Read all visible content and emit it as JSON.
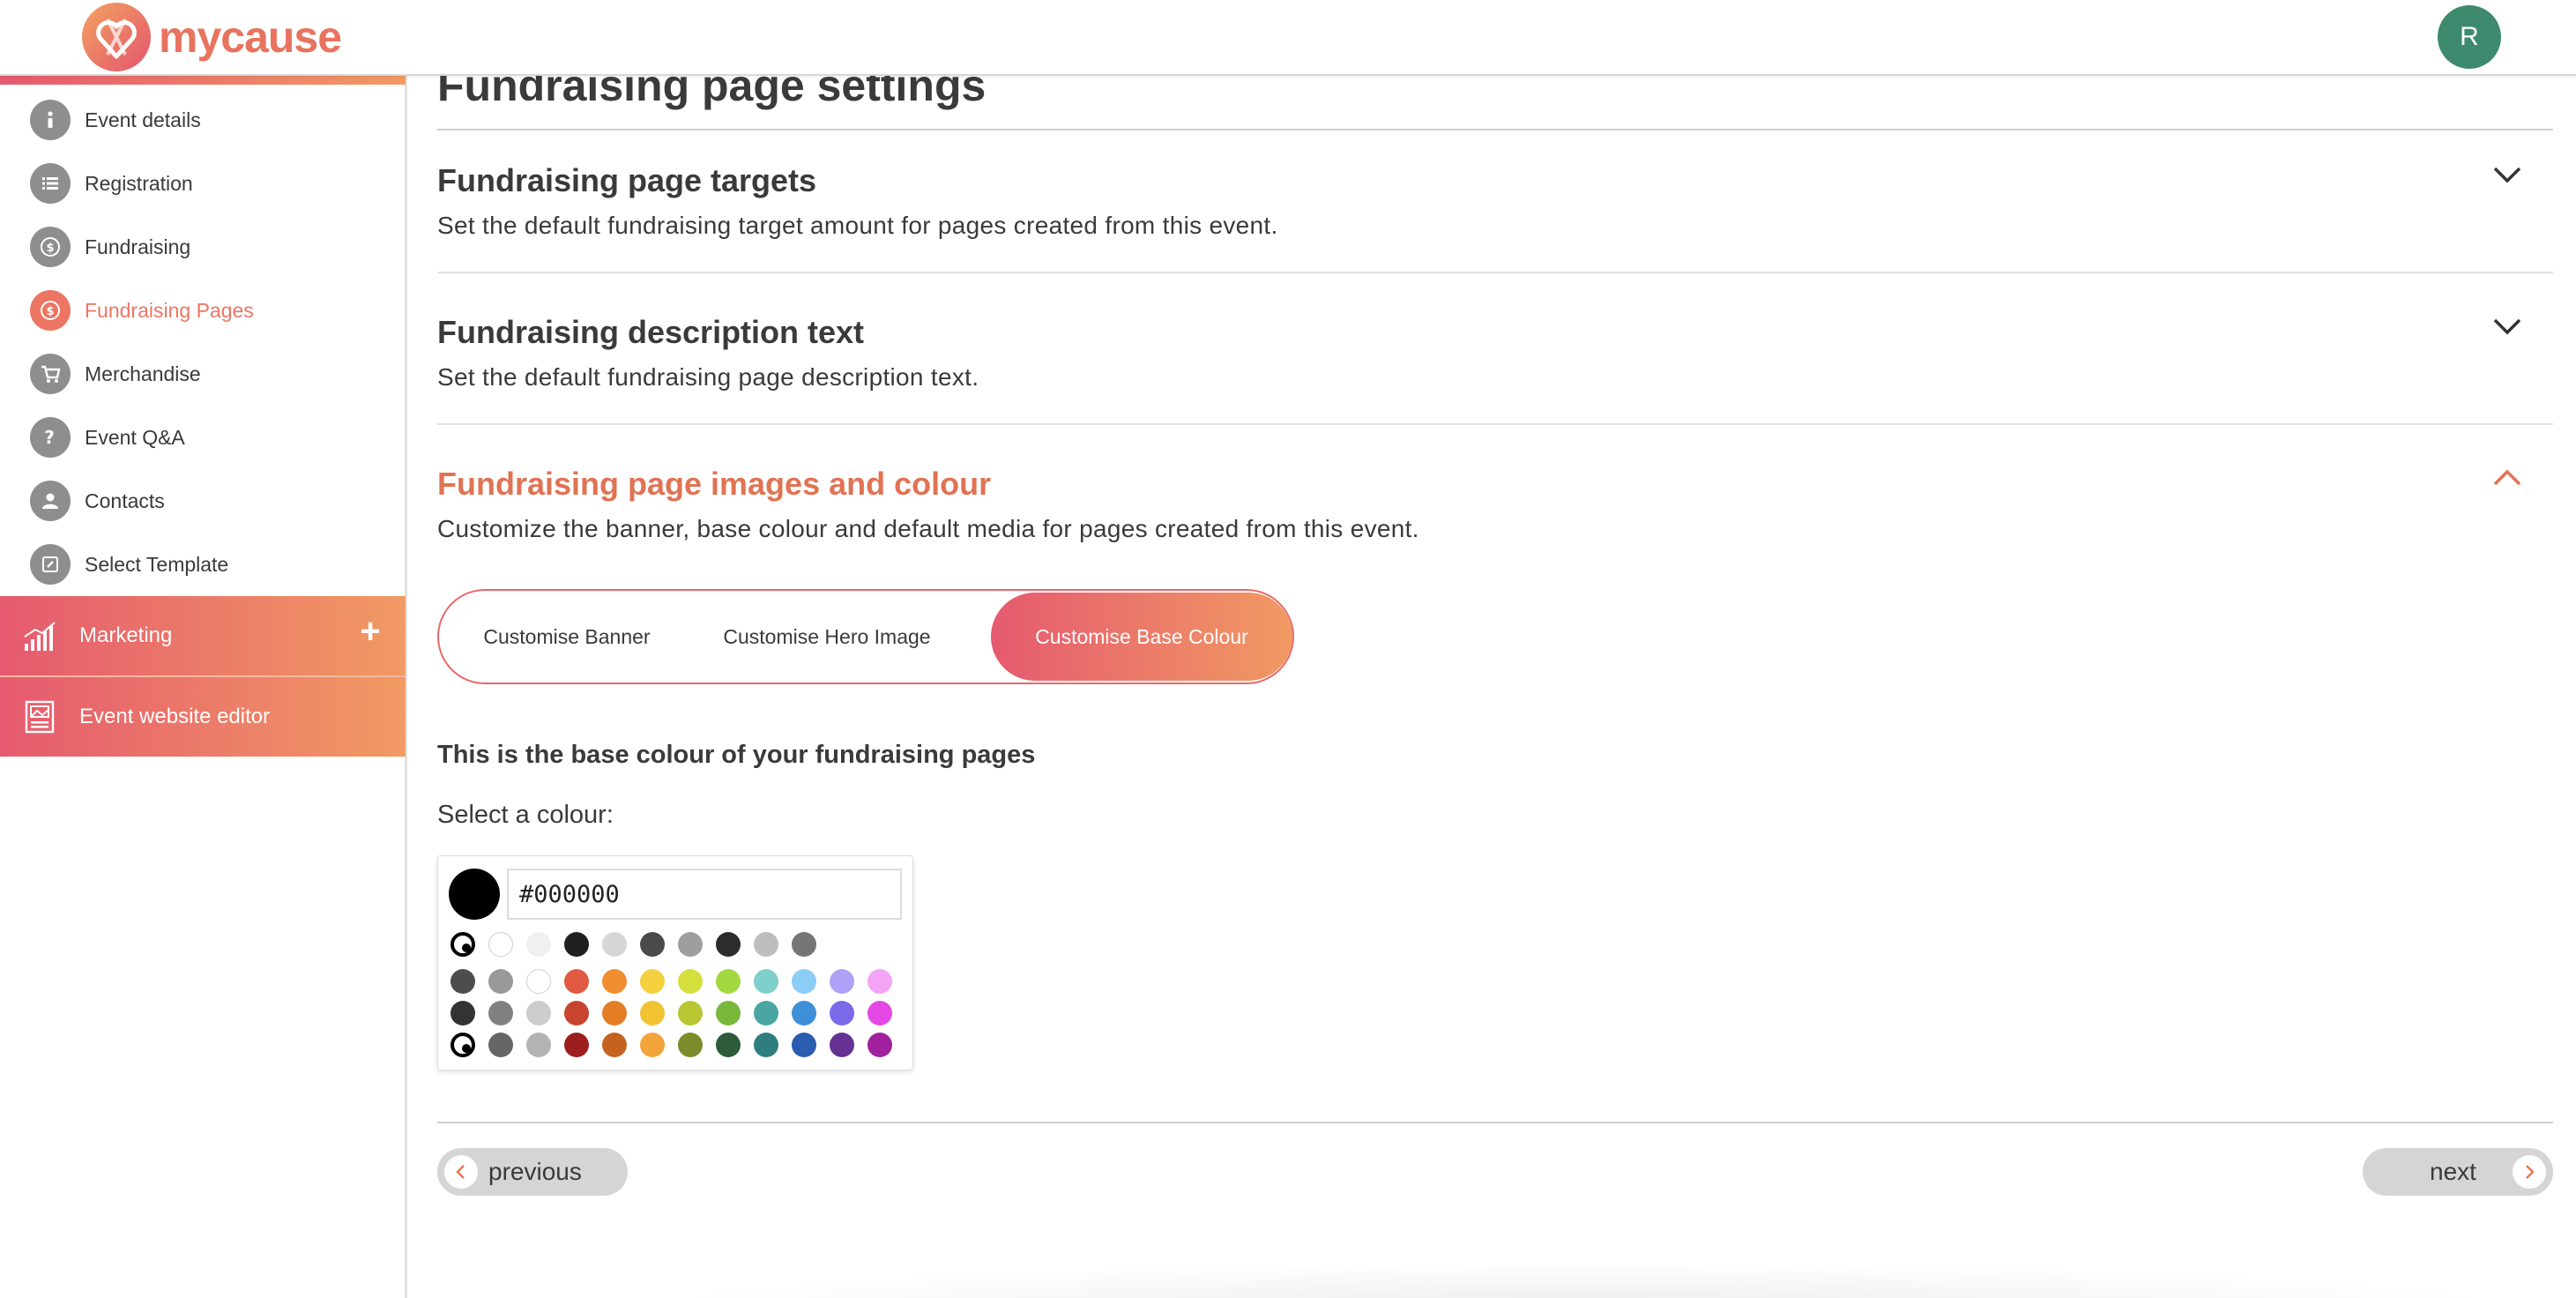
{
  "app": {
    "brand": "mycause",
    "avatar_initial": "R"
  },
  "sidebar": {
    "items": [
      {
        "label": "Event details",
        "icon": "info-icon",
        "active": false
      },
      {
        "label": "Registration",
        "icon": "list-icon",
        "active": false
      },
      {
        "label": "Fundraising",
        "icon": "dollar-icon",
        "active": false
      },
      {
        "label": "Fundraising Pages",
        "icon": "dollar-icon",
        "active": true
      },
      {
        "label": "Merchandise",
        "icon": "cart-icon",
        "active": false
      },
      {
        "label": "Event Q&A",
        "icon": "question-icon",
        "active": false
      },
      {
        "label": "Contacts",
        "icon": "person-icon",
        "active": false
      },
      {
        "label": "Select Template",
        "icon": "edit-icon",
        "active": false
      }
    ],
    "marketing": {
      "label": "Marketing",
      "icon": "chart-icon"
    },
    "website_editor": {
      "label": "Event website editor",
      "icon": "website-icon"
    }
  },
  "main": {
    "title": "Fundraising page settings",
    "sections": [
      {
        "title": "Fundraising page targets",
        "description": "Set the default fundraising target amount for pages created from this event.",
        "expanded": false
      },
      {
        "title": "Fundraising description text",
        "description": "Set the default fundraising page description text.",
        "expanded": false
      },
      {
        "title": "Fundraising page images and colour",
        "description": "Customize the banner, base colour and default media for pages created from this event.",
        "expanded": true
      }
    ],
    "tabs": [
      {
        "label": "Customise Banner",
        "active": false
      },
      {
        "label": "Customise Hero Image",
        "active": false
      },
      {
        "label": "Customise Base Colour",
        "active": true
      }
    ],
    "base_heading": "This is the base colour of your fundraising pages",
    "select_label": "Select a colour:",
    "color_picker": {
      "value": "#000000",
      "recent": [
        "#000000",
        "#ffffff",
        "#f0f0f0",
        "#1f1f1f",
        "#d6d6d6",
        "#4a4a4a",
        "#9e9e9e",
        "#2c2c2c",
        "#bdbdbd",
        "#757575"
      ],
      "palette": [
        [
          "#4d4d4d",
          "#999999",
          "#ffffff",
          "#e05940",
          "#f08d2e",
          "#f5d03f",
          "#d5df3e",
          "#a3d841",
          "#7fcfcb",
          "#8ccdf5",
          "#aea1f7",
          "#f4a4f4"
        ],
        [
          "#333333",
          "#808080",
          "#cccccc",
          "#c9442e",
          "#e37e24",
          "#f1c232",
          "#b8c634",
          "#7ab83b",
          "#4aa6a3",
          "#3f8fd8",
          "#7a6ae8",
          "#e448e4"
        ],
        [
          "#000000",
          "#666666",
          "#b3b3b3",
          "#9e1e1e",
          "#c4621f",
          "#f3a43a",
          "#7c8c2c",
          "#2d5b3a",
          "#2f7e7f",
          "#2a5caf",
          "#653294",
          "#a0209e"
        ]
      ]
    },
    "footer": {
      "previous": "previous",
      "next": "next"
    }
  }
}
